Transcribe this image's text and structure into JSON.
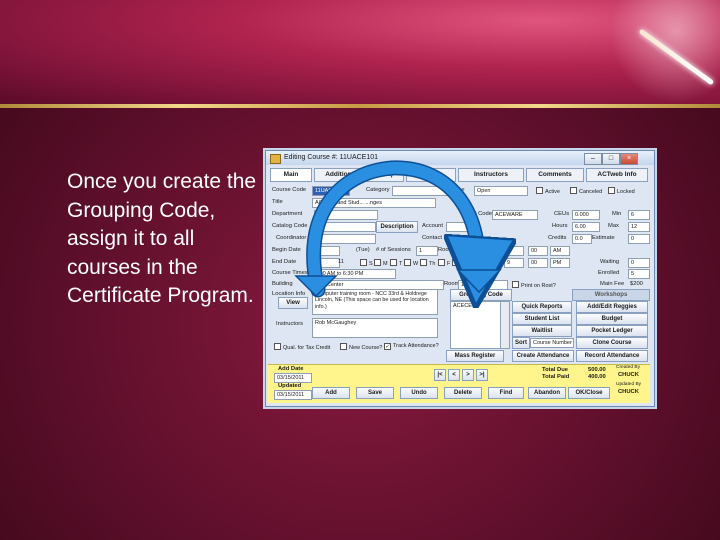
{
  "slide": {
    "caption": "Once you create the Grouping Code, assign it to all courses in the Certificate Program."
  },
  "window": {
    "title": "Editing Course #: 11UACE101",
    "tabs": [
      "Main",
      "Additional Info (IDBN)",
      "Fees",
      "Instructors",
      "Comments",
      "ACTweb Info"
    ],
    "fields": {
      "course_code_label": "Course Code",
      "course_code_value": "11UACE101",
      "category_label": "Category",
      "type_label": "Type",
      "type_value": "Open",
      "active": "Active",
      "canceled": "Canceled",
      "locked": "Locked",
      "title_label": "Title",
      "title_value": "ACTweb and Stud... ...nges",
      "department_label": "Department",
      "grant_code_label": "Grant Code",
      "grant_code_value": "ACEWARE",
      "ceus_label": "CEUs",
      "ceus_value": "0.000",
      "min_label": "Min",
      "min_value": "6",
      "catalog_code_label": "Catalog Code",
      "description_button": "Description",
      "account_label": "Account",
      "hours_label": "Hours",
      "hours_value": "6.00",
      "max_label": "Max",
      "max_value": "12",
      "coordinator_label": "Coordinator",
      "contact_hours_label": "Contact H",
      "credits_label": "Credits",
      "credits_value": "0.0",
      "estimate_label": "Estimate",
      "estimate_value": "0",
      "begin_date_label": "Begin Date",
      "begin_date_value": "07",
      "tue_label": "(Tue)",
      "sessions_label": "# of Sessions",
      "sessions_value": "1",
      "rooms_label": "Room",
      "start_time_label": "Start Time",
      "start_hour": "9",
      "start_min": "00",
      "start_ampm": "AM",
      "end_date_label": "End Date",
      "end_date_value": "07",
      "end_day_value": "11",
      "days": [
        "S",
        "M",
        "T",
        "W",
        "Th",
        "F",
        "S"
      ],
      "end_hour": "9",
      "end_min": "00",
      "end_ampm": "PM",
      "waiting_label": "Waiting",
      "waiting_value": "0",
      "course_times_label": "Course Times",
      "course_times_value": "9:00 AM to 6:30 PM",
      "enrolled_label": "Enrolled",
      "enrolled_value": "5",
      "building_label": "Building",
      "building_value": "...ka Center",
      "room_label": "Room",
      "room_value": "11",
      "print_roster": "Print on Rost?",
      "main_fee_label": "Main Fee",
      "main_fee_value": "$200",
      "location_info_label": "Location Info",
      "view_button": "View",
      "location_text": "Computer training room - NCC 33rd & Holdrege Lincoln, NE (This space can be used for location info.)",
      "grouping_code_button": "Grouping Code",
      "grouping_code_value": "ACECER",
      "instructors_label": "Instructors",
      "instructors_value": "Rob McGaughey",
      "qual_tax_credit": "Qual. for Tax Credit",
      "new_course": "New Course?",
      "track_attendance": "Track Attendance?",
      "course_number_label": "Course Number"
    },
    "right_buttons": [
      "Workshops",
      "Quick Reports",
      "Add/Edit Reggies",
      "Student List",
      "Budget",
      "Waitlist",
      "Pocket Ledger",
      "Sort",
      "Clone Course",
      "Mass Register",
      "Create Attendance",
      "Record Attendance"
    ],
    "bottom": {
      "add_date_label": "Add Date",
      "add_date_value": "03/15/2011",
      "updated_label": "Updated",
      "updated_value": "03/15/2011",
      "nav": [
        "|<",
        "<",
        ">",
        ">|"
      ],
      "total_due_label": "Total Due",
      "total_due_value": "500.00",
      "total_paid_label": "Total Paid",
      "total_paid_value": "400.00",
      "created_by_label": "Created By",
      "created_by_value": "CHUCK",
      "updated_by_label": "Updated By",
      "updated_by_value": "CHUCK",
      "actions": [
        "Add",
        "Save",
        "Undo",
        "Delete",
        "Find",
        "Abandon",
        "OK/Close"
      ]
    }
  },
  "colors": {
    "arrow": "#2a8fe0",
    "highlight_bar": "#fff58c",
    "selected_field": "#2f5fb0"
  }
}
